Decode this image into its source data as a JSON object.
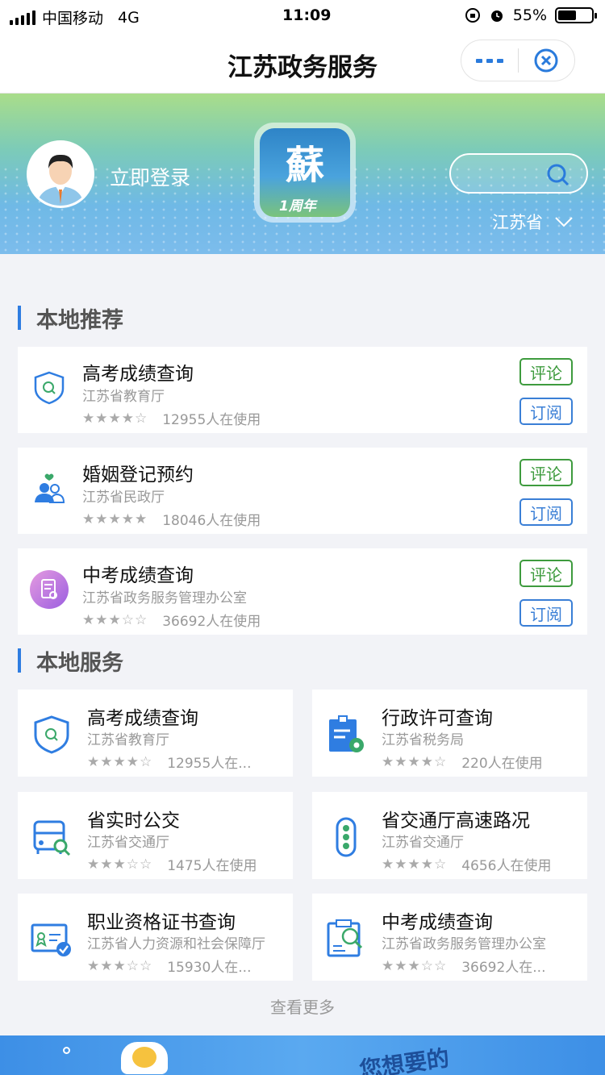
{
  "status_bar": {
    "carrier": "中国移动",
    "network": "4G",
    "time": "11:09",
    "battery_percent": "55%",
    "battery_level": 0.55
  },
  "header": {
    "title": "江苏政务服务"
  },
  "banner": {
    "login_text": "立即登录",
    "logo_char": "蘇",
    "logo_sub": "1周年",
    "region": "江苏省"
  },
  "recommend": {
    "title": "本地推荐",
    "items": [
      {
        "title": "高考成绩查询",
        "dept": "江苏省教育厅",
        "stars": "★★★★☆",
        "rating": 4,
        "usage": "12955人在使用",
        "comment": "评论",
        "subscribe": "订阅",
        "icon": "shield-search-icon"
      },
      {
        "title": "婚姻登记预约",
        "dept": "江苏省民政厅",
        "stars": "★★★★★",
        "rating": 5,
        "usage": "18046人在使用",
        "comment": "评论",
        "subscribe": "订阅",
        "icon": "marriage-couple-icon"
      },
      {
        "title": "中考成绩查询",
        "dept": "江苏省政务服务管理办公室",
        "stars": "★★★☆☆",
        "rating": 3,
        "usage": "36692人在使用",
        "comment": "评论",
        "subscribe": "订阅",
        "icon": "document-search-icon"
      }
    ]
  },
  "services": {
    "title": "本地服务",
    "items": [
      {
        "title": "高考成绩查询",
        "dept": "江苏省教育厅",
        "stars": "★★★★☆",
        "rating": 4,
        "usage": "12955人在...",
        "icon": "shield-search-icon"
      },
      {
        "title": "行政许可查询",
        "dept": "江苏省税务局",
        "stars": "★★★★☆",
        "rating": 4,
        "usage": "220人在使用",
        "icon": "document-gear-icon"
      },
      {
        "title": "省实时公交",
        "dept": "江苏省交通厅",
        "stars": "★★★☆☆",
        "rating": 3,
        "usage": "1475人在使用",
        "icon": "bus-search-icon"
      },
      {
        "title": "省交通厅高速路况",
        "dept": "江苏省交通厅",
        "stars": "★★★★☆",
        "rating": 4,
        "usage": "4656人在使用",
        "icon": "traffic-light-icon"
      },
      {
        "title": "职业资格证书查询",
        "dept": "江苏省人力资源和社会保障厅",
        "stars": "★★★☆☆",
        "rating": 3,
        "usage": "15930人在...",
        "icon": "certificate-icon"
      },
      {
        "title": "中考成绩查询",
        "dept": "江苏省政务服务管理办公室",
        "stars": "★★★☆☆",
        "rating": 3,
        "usage": "36692人在...",
        "icon": "exam-search-icon"
      }
    ],
    "see_more": "查看更多"
  },
  "bottom_banner": {
    "text": "您想要的"
  },
  "colors": {
    "accent_blue": "#2f7de1",
    "comment_green": "#3e9b3e",
    "subscribe_blue": "#3a7fd6"
  }
}
